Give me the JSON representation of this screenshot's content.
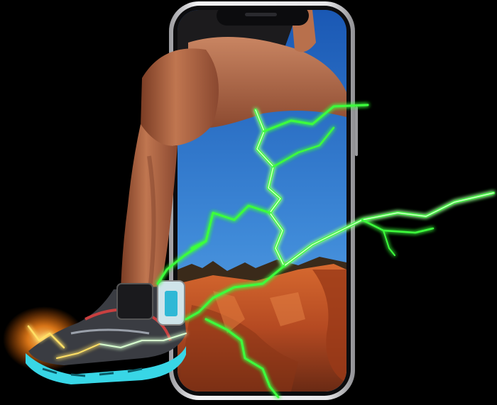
{
  "scene": {
    "subject": "runner-leg-breaking-out-of-smartphone",
    "colors": {
      "background": "#000000",
      "sky_top": "#1f5fb8",
      "sky_bottom": "#4a97e0",
      "rock": "#c2552a",
      "rock_dark": "#7a2f16",
      "skin": "#b96d48",
      "skin_shadow": "#6e3522",
      "shorts": "#1c1b1d",
      "phone_frame": "#d9d9dc",
      "phone_bezel": "#0c0c0e",
      "lightning": "#3cff3c",
      "lightning_core": "#d8ffd0",
      "glow_orange": "#ff8a1c",
      "sole_cyan": "#38d6e6"
    }
  }
}
